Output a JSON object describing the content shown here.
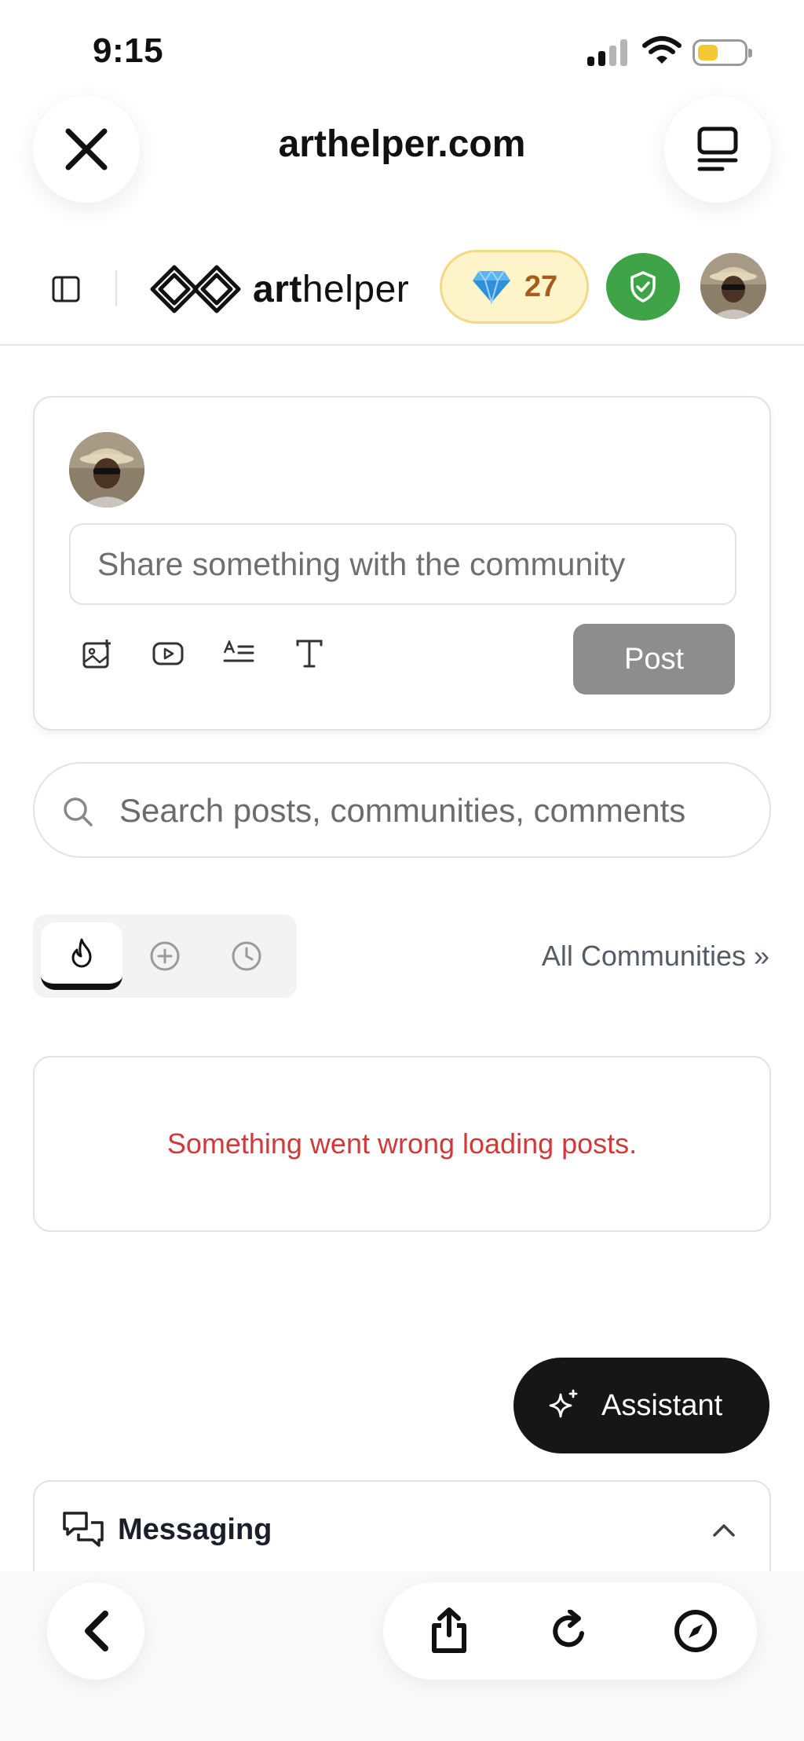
{
  "status_bar": {
    "time": "9:15"
  },
  "browser": {
    "site_title": "arthelper.com",
    "close_icon": "close-icon",
    "tabs_icon": "tabs-icon",
    "back_icon": "chevron-left-icon",
    "share_icon": "share-icon",
    "reload_icon": "reload-icon",
    "compass_icon": "compass-icon"
  },
  "header": {
    "logo_bold": "art",
    "logo_rest": "helper",
    "gems_count": "27",
    "gem_icon": "diamond-icon",
    "shield_icon": "shield-check-icon",
    "shield_color": "#3fa447",
    "gems_text_color": "#a85b1a"
  },
  "composer": {
    "placeholder": "Share something with the community",
    "tools": [
      "image-icon",
      "video-icon",
      "list-icon",
      "text-icon"
    ],
    "post_label": "Post"
  },
  "search": {
    "placeholder": "Search posts, communities, comments"
  },
  "feed": {
    "sort_tabs": [
      "hot-icon",
      "new-icon",
      "recent-icon"
    ],
    "active_tab": "hot-icon",
    "all_communities_label": "All Communities »",
    "error_message": "Something went wrong loading posts.",
    "error_color": "#d13a3a"
  },
  "assistant": {
    "label": "Assistant",
    "icon": "sparkle-icon"
  },
  "messaging": {
    "title": "Messaging",
    "icon": "chat-icon"
  }
}
